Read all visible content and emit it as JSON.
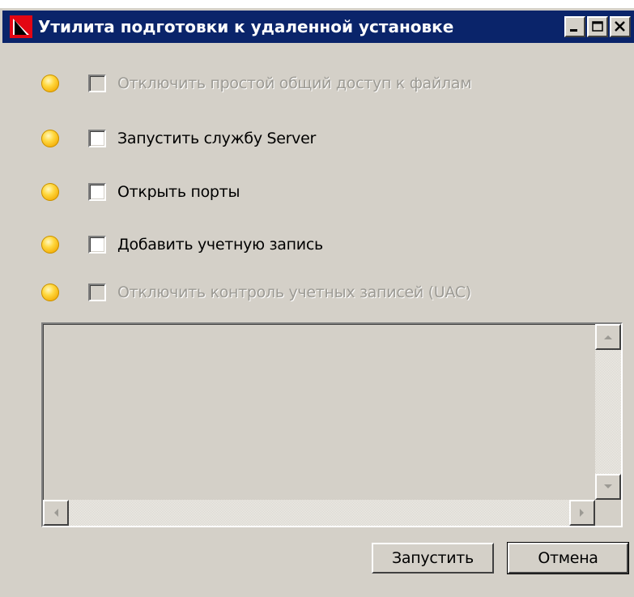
{
  "window": {
    "title": "Утилита подготовки к удаленной установке",
    "title_bg": "#0a246a",
    "title_color": "#ffffff",
    "body_bg": "#d4d0c8"
  },
  "title_buttons": [
    "minimize-icon",
    "maximize-icon",
    "close-icon"
  ],
  "options": [
    {
      "label": "Отключить простой общий доступ к файлам",
      "checked": false,
      "enabled": false,
      "status_icon": "yellow-bulb-icon"
    },
    {
      "label": "Запустить службу Server",
      "checked": false,
      "enabled": true,
      "status_icon": "yellow-bulb-icon"
    },
    {
      "label": "Открыть порты",
      "checked": false,
      "enabled": true,
      "status_icon": "yellow-bulb-icon"
    },
    {
      "label": "Добавить учетную запись",
      "checked": false,
      "enabled": true,
      "status_icon": "yellow-bulb-icon"
    },
    {
      "label": "Отключить контроль учетных записей (UAC)",
      "checked": false,
      "enabled": false,
      "status_icon": "yellow-bulb-icon"
    }
  ],
  "log": {
    "text": ""
  },
  "buttons": {
    "run_label": "Запустить",
    "cancel_label": "Отмена"
  }
}
